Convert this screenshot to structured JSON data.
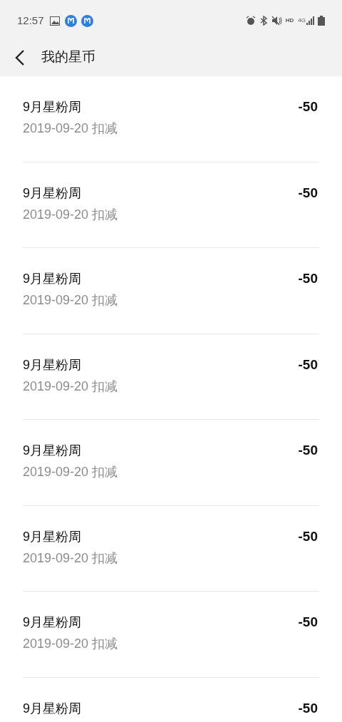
{
  "status_bar": {
    "time": "12:57",
    "network_label": "HD",
    "network_type": "4G"
  },
  "header": {
    "title": "我的星币"
  },
  "records": [
    {
      "title": "9月星粉周",
      "date": "2019-09-20 扣减",
      "amount": "-50"
    },
    {
      "title": "9月星粉周",
      "date": "2019-09-20 扣减",
      "amount": "-50"
    },
    {
      "title": "9月星粉周",
      "date": "2019-09-20 扣减",
      "amount": "-50"
    },
    {
      "title": "9月星粉周",
      "date": "2019-09-20 扣减",
      "amount": "-50"
    },
    {
      "title": "9月星粉周",
      "date": "2019-09-20 扣减",
      "amount": "-50"
    },
    {
      "title": "9月星粉周",
      "date": "2019-09-20 扣减",
      "amount": "-50"
    },
    {
      "title": "9月星粉周",
      "date": "2019-09-20 扣减",
      "amount": "-50"
    },
    {
      "title": "9月星粉周",
      "amount": "-50"
    }
  ]
}
